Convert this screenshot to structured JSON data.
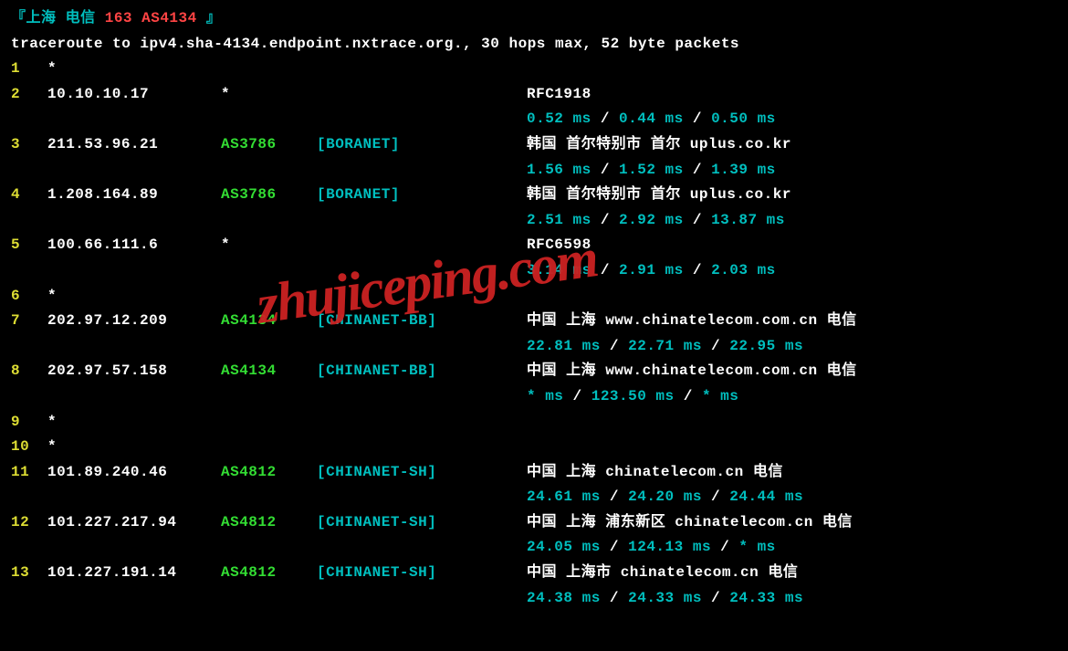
{
  "header": {
    "prefix": "『上海 电信 ",
    "red": "163 AS4134",
    "suffix": " 』"
  },
  "traceroute_line": "traceroute to ipv4.sha-4134.endpoint.nxtrace.org., 30 hops max, 52 byte packets",
  "hops": [
    {
      "num": "1",
      "ip": "*",
      "asn": "",
      "netname": "",
      "location": "",
      "timing": ""
    },
    {
      "num": "2",
      "ip": "10.10.10.17",
      "asn": "*",
      "netname": "",
      "location": "RFC1918",
      "timing": "0.52 ms / 0.44 ms / 0.50 ms"
    },
    {
      "num": "3",
      "ip": "211.53.96.21",
      "asn": "AS3786",
      "netname": "[BORANET]",
      "location": "韩国 首尔特别市 首尔  uplus.co.kr",
      "timing": "1.56 ms / 1.52 ms / 1.39 ms"
    },
    {
      "num": "4",
      "ip": "1.208.164.89",
      "asn": "AS3786",
      "netname": "[BORANET]",
      "location": "韩国 首尔特别市 首尔  uplus.co.kr",
      "timing": "2.51 ms / 2.92 ms / 13.87 ms"
    },
    {
      "num": "5",
      "ip": "100.66.111.6",
      "asn": "*",
      "netname": "",
      "location": "RFC6598",
      "timing": "3.14 ms / 2.91 ms / 2.03 ms"
    },
    {
      "num": "6",
      "ip": "*",
      "asn": "",
      "netname": "",
      "location": "",
      "timing": ""
    },
    {
      "num": "7",
      "ip": "202.97.12.209",
      "asn": "AS4134",
      "netname": "[CHINANET-BB]",
      "location": "中国 上海   www.chinatelecom.com.cn  电信",
      "timing": "22.81 ms / 22.71 ms / 22.95 ms"
    },
    {
      "num": "8",
      "ip": "202.97.57.158",
      "asn": "AS4134",
      "netname": "[CHINANET-BB]",
      "location": "中国 上海   www.chinatelecom.com.cn  电信",
      "timing": "* ms / 123.50 ms / * ms"
    },
    {
      "num": "9",
      "ip": "*",
      "asn": "",
      "netname": "",
      "location": "",
      "timing": ""
    },
    {
      "num": "10",
      "ip": "*",
      "asn": "",
      "netname": "",
      "location": "",
      "timing": ""
    },
    {
      "num": "11",
      "ip": "101.89.240.46",
      "asn": "AS4812",
      "netname": "[CHINANET-SH]",
      "location": "中国 上海   chinatelecom.cn  电信",
      "timing": "24.61 ms / 24.20 ms / 24.44 ms"
    },
    {
      "num": "12",
      "ip": "101.227.217.94",
      "asn": "AS4812",
      "netname": "[CHINANET-SH]",
      "location": "中国 上海  浦东新区 chinatelecom.cn  电信",
      "timing": "24.05 ms / 124.13 ms / * ms"
    },
    {
      "num": "13",
      "ip": "101.227.191.14",
      "asn": "AS4812",
      "netname": "[CHINANET-SH]",
      "location": "中国 上海市   chinatelecom.cn  电信",
      "timing": "24.38 ms / 24.33 ms / 24.33 ms"
    }
  ],
  "watermark": "zhujiceping.com"
}
